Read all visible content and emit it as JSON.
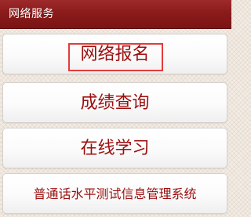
{
  "header": {
    "title": "网络服务"
  },
  "menu": {
    "items": [
      {
        "label": "网络报名"
      },
      {
        "label": "成绩查询"
      },
      {
        "label": "在线学习"
      },
      {
        "label": "普通话水平测试信息管理系统"
      }
    ]
  },
  "colors": {
    "header_bg": "#8a1b1b",
    "label_text": "#9b0e0e",
    "highlight_border": "#e33b3b",
    "page_bg": "#f3ece4"
  }
}
